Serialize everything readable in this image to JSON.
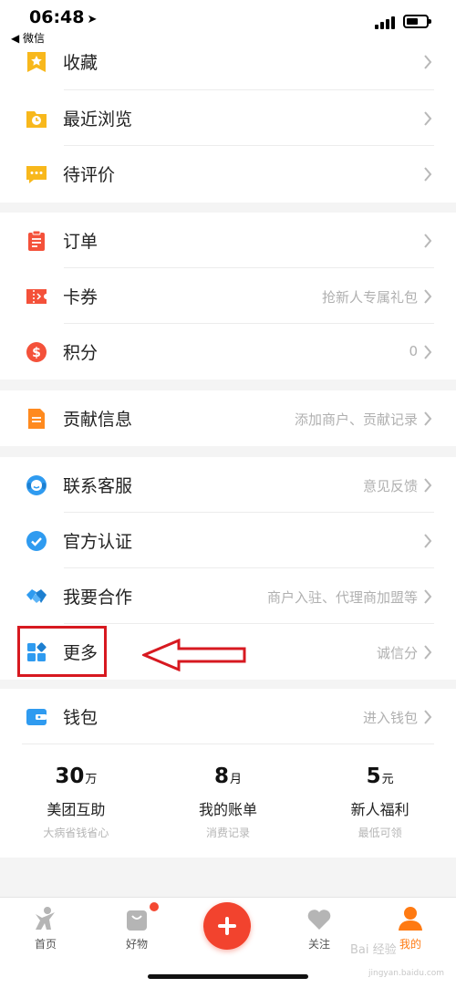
{
  "status": {
    "time": "06:48",
    "back_app": "◀ 微信"
  },
  "section1": [
    {
      "label": "收藏",
      "hint": ""
    },
    {
      "label": "最近浏览",
      "hint": ""
    },
    {
      "label": "待评价",
      "hint": ""
    }
  ],
  "section2": [
    {
      "label": "订单",
      "hint": ""
    },
    {
      "label": "卡券",
      "hint": "抢新人专属礼包"
    },
    {
      "label": "积分",
      "hint": "0"
    }
  ],
  "section3": [
    {
      "label": "贡献信息",
      "hint": "添加商户、贡献记录"
    }
  ],
  "section4": [
    {
      "label": "联系客服",
      "hint": "意见反馈"
    },
    {
      "label": "官方认证",
      "hint": ""
    },
    {
      "label": "我要合作",
      "hint": "商户入驻、代理商加盟等"
    },
    {
      "label": "更多",
      "hint": "诚信分"
    }
  ],
  "wallet": {
    "label": "钱包",
    "hint": "进入钱包",
    "stats": [
      {
        "num": "30",
        "unit": "万",
        "title": "美团互助",
        "sub": "大病省钱省心"
      },
      {
        "num": "8",
        "unit": "月",
        "title": "我的账单",
        "sub": "消费记录"
      },
      {
        "num": "5",
        "unit": "元",
        "title": "新人福利",
        "sub": "最低可领"
      }
    ]
  },
  "tabbar": {
    "home": "首页",
    "goods": "好物",
    "follow": "关注",
    "mine": "我的"
  },
  "watermark": {
    "main": "Bai 经验",
    "sub": "jingyan.baidu.com"
  },
  "colors": {
    "accent": "#ff7a12",
    "red": "#d71920",
    "plus": "#f2432e"
  }
}
